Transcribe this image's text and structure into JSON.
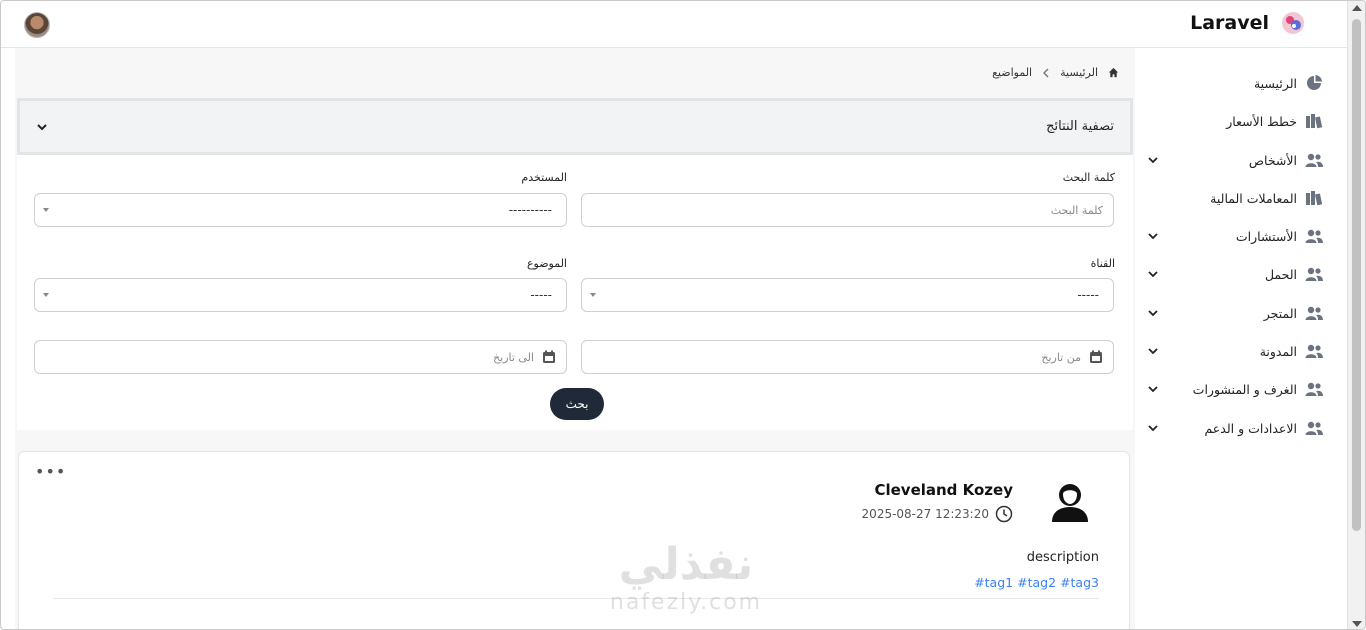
{
  "brand": {
    "name": "Laravel"
  },
  "breadcrumb": {
    "home": "الرئيسية",
    "current": "المواضيع"
  },
  "sidebar": {
    "items": [
      {
        "label": "الرئيسية",
        "icon": "pie-chart-icon",
        "has_children": false
      },
      {
        "label": "خطط الأسعار",
        "icon": "books-icon",
        "has_children": false
      },
      {
        "label": "الأشخاص",
        "icon": "users-icon",
        "has_children": true
      },
      {
        "label": "المعاملات المالية",
        "icon": "books-icon",
        "has_children": false
      },
      {
        "label": "الأستشارات",
        "icon": "users-icon",
        "has_children": true
      },
      {
        "label": "الحمل",
        "icon": "users-icon",
        "has_children": true
      },
      {
        "label": "المتجر",
        "icon": "users-icon",
        "has_children": true
      },
      {
        "label": "المدونة",
        "icon": "users-icon",
        "has_children": true
      },
      {
        "label": "الغرف و المنشورات",
        "icon": "users-icon",
        "has_children": true
      },
      {
        "label": "الاعدادات و الدعم",
        "icon": "users-icon",
        "has_children": true
      }
    ]
  },
  "filter": {
    "title": "تصفية النتائج",
    "keyword": {
      "label": "كلمة البحث",
      "placeholder": "كلمة البحث"
    },
    "user": {
      "label": "المستخدم",
      "value": "----------"
    },
    "channel": {
      "label": "القناة",
      "value": "-----"
    },
    "topic": {
      "label": "الموضوع",
      "value": "-----"
    },
    "from_date": {
      "placeholder": "من تاريخ"
    },
    "to_date": {
      "placeholder": "الى تاريخ"
    },
    "search_label": "بحث"
  },
  "post": {
    "author": "Cleveland Kozey",
    "timestamp": "2025-08-27 12:23:20",
    "description": "description",
    "tags": [
      "#tag1",
      "#tag2",
      "#tag3"
    ]
  },
  "watermark": {
    "arabic": "نفذلي",
    "latin": "nafezly.com"
  },
  "colors": {
    "accent": "#1f2937",
    "link": "#3b82f6",
    "filter_header": "#f2f3f5"
  }
}
